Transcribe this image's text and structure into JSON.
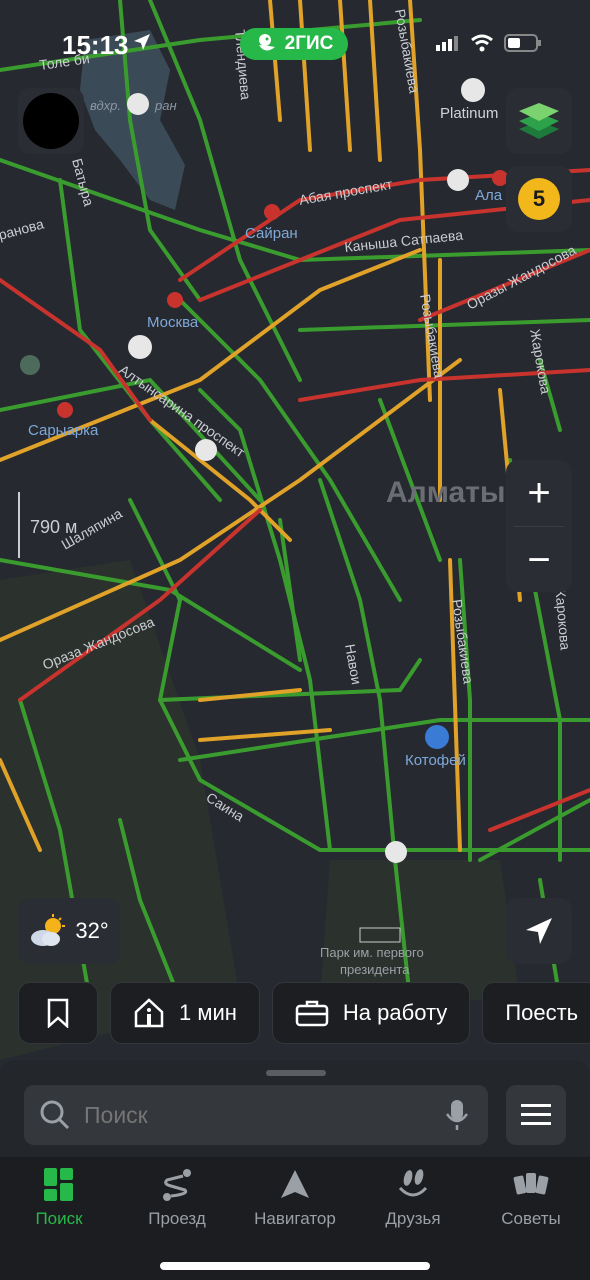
{
  "status_bar": {
    "time": "15:13",
    "brand": "2ГИС"
  },
  "map": {
    "scale": "790 м",
    "city_label": "Алматы",
    "streets": [
      "Толе би",
      "Абая проспект",
      "Каныша Сатпаева",
      "Оразы Жандосова",
      "Розыбакиева",
      "Жарокова",
      "Тлендиева",
      "Шаляпина",
      "Алтынсарина проспект",
      "Навои",
      "Саина",
      "Батыра",
      "Оразa Жандосова"
    ],
    "metro_stations": [
      "Сайран",
      "Москва",
      "Сарыарка",
      "Ала"
    ],
    "pois": [
      "Platinum",
      "Котофей",
      "Парк им. первого президента",
      "вдхр. Сайран"
    ]
  },
  "controls": {
    "layers_badge": "5",
    "zoom_in": "+",
    "zoom_out": "−"
  },
  "weather": {
    "temp": "32°"
  },
  "chips": [
    {
      "icon": "bookmark-icon",
      "label": ""
    },
    {
      "icon": "home-icon",
      "label": "1 мин"
    },
    {
      "icon": "briefcase-icon",
      "label": "На работу"
    },
    {
      "icon": "",
      "label": "Поесть"
    }
  ],
  "search": {
    "placeholder": "Поиск"
  },
  "tabs": [
    {
      "label": "Поиск",
      "icon": "grid-icon",
      "active": true
    },
    {
      "label": "Проезд",
      "icon": "route-icon",
      "active": false
    },
    {
      "label": "Навигатор",
      "icon": "navigator-icon",
      "active": false
    },
    {
      "label": "Друзья",
      "icon": "friends-icon",
      "active": false
    },
    {
      "label": "Советы",
      "icon": "cards-icon",
      "active": false
    }
  ],
  "colors": {
    "accent": "#27b84a",
    "traffic_green": "#3a9c2e",
    "traffic_yellow": "#e0a228",
    "traffic_red": "#c8332e",
    "badge": "#f2b71b"
  }
}
